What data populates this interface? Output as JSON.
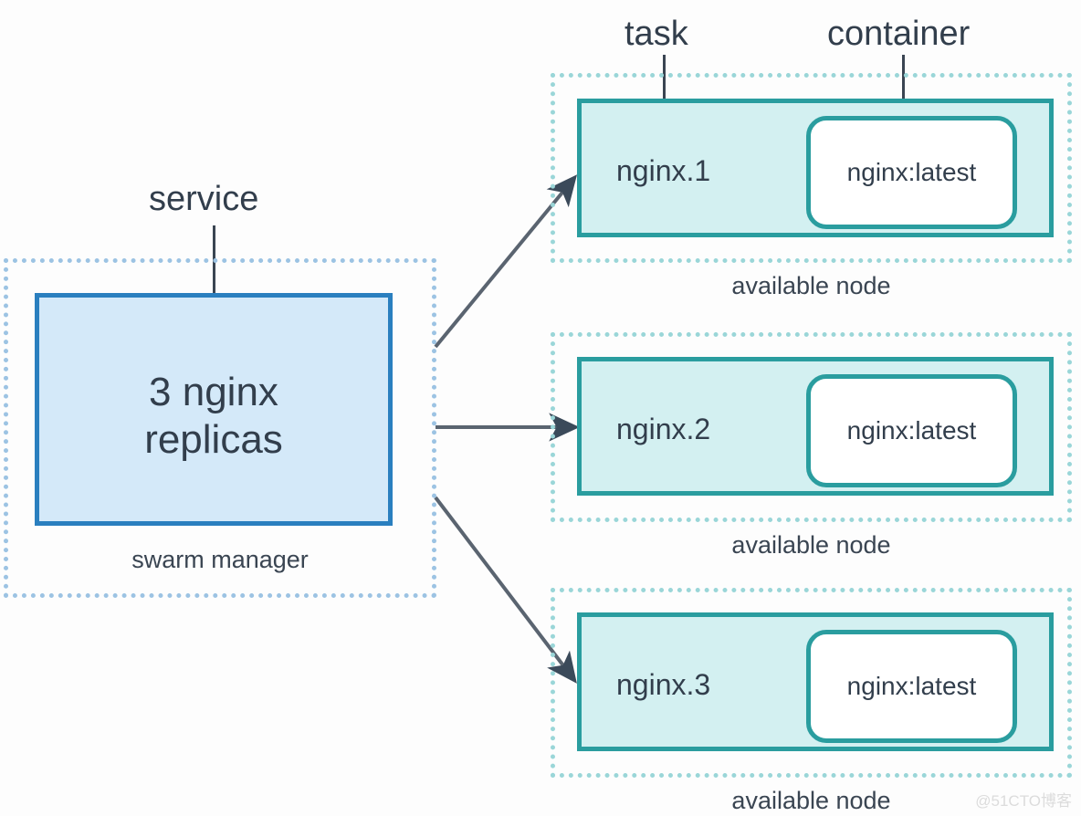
{
  "diagram": {
    "title": "Docker Swarm service / task / container diagram",
    "colors": {
      "service_fill": "#d4e9f9",
      "service_border": "#2a7fbf",
      "service_dotted": "#9cc3e3",
      "task_fill": "#d3f0f1",
      "task_border": "#2a9d9f",
      "node_dotted": "#9ad6d8",
      "container_fill": "#ffffff",
      "text": "#323e4c",
      "arrow": "#5a6470",
      "background": "#fdfdfd",
      "watermark": "#dcdcdc"
    },
    "annotations": {
      "service": "service",
      "task": "task",
      "container": "container"
    },
    "manager": {
      "caption": "swarm manager",
      "service_label": "3 nginx\nreplicas"
    },
    "nodes": [
      {
        "task_label": "nginx.1",
        "container_label": "nginx:latest",
        "caption": "available node"
      },
      {
        "task_label": "nginx.2",
        "container_label": "nginx:latest",
        "caption": "available node"
      },
      {
        "task_label": "nginx.3",
        "container_label": "nginx:latest",
        "caption": "available node"
      }
    ],
    "watermark": "@51CTO博客"
  }
}
